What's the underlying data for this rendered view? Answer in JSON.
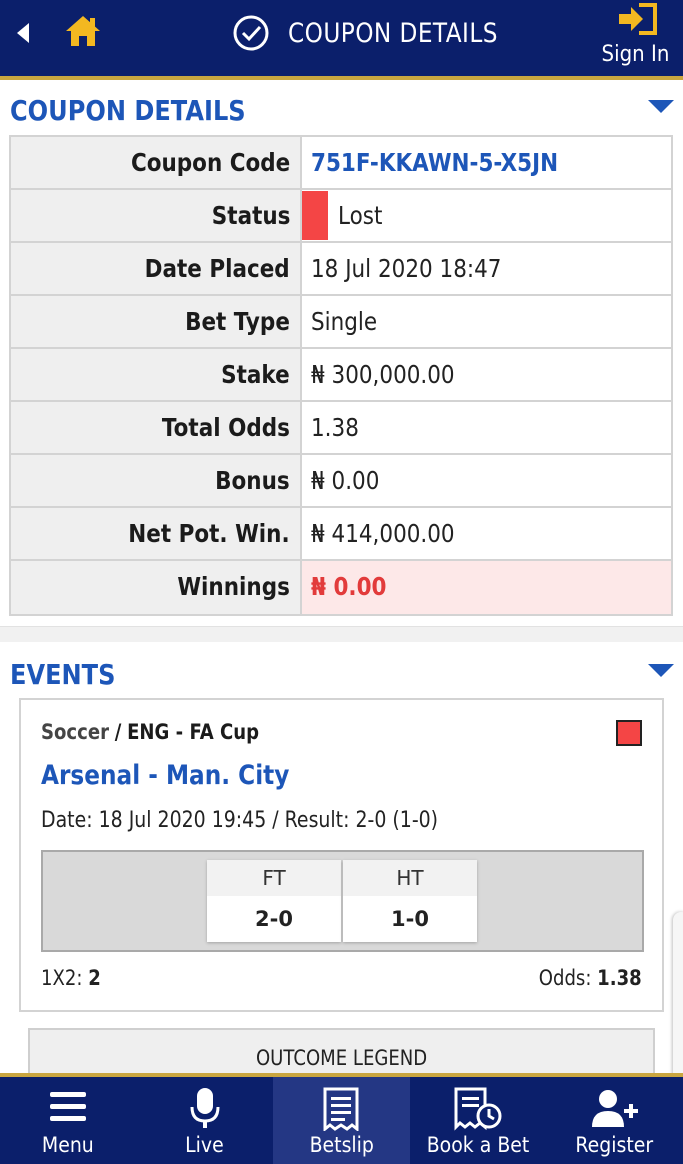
{
  "header": {
    "title": "COUPON DETAILS",
    "sign_in_label": "Sign In",
    "colors": {
      "bar": "#0b1f6b",
      "accent": "#c9a640",
      "home_icon": "#f3b821"
    }
  },
  "coupon_section": {
    "title": "COUPON DETAILS",
    "rows": [
      {
        "label": "Coupon Code",
        "value": "751F-KKAWN-5-X5JN"
      },
      {
        "label": "Status",
        "value": "Lost"
      },
      {
        "label": "Date Placed",
        "value": "18 Jul 2020 18:47"
      },
      {
        "label": "Bet Type",
        "value": "Single"
      },
      {
        "label": "Stake",
        "value": "₦ 300,000.00"
      },
      {
        "label": "Total Odds",
        "value": "1.38"
      },
      {
        "label": "Bonus",
        "value": "₦ 0.00"
      },
      {
        "label": "Net Pot. Win.",
        "value": "₦ 414,000.00"
      },
      {
        "label": "Winnings",
        "value": "₦ 0.00"
      }
    ],
    "status_color": "#f44545"
  },
  "events_section": {
    "title": "EVENTS",
    "event": {
      "sport": "Soccer",
      "separator": "/",
      "competition": "ENG - FA Cup",
      "match": "Arsenal - Man. City",
      "date_result": "Date: 18 Jul 2020 19:45 / Result: 2-0 (1-0)",
      "scores": [
        {
          "label": "FT",
          "value": "2-0"
        },
        {
          "label": "HT",
          "value": "1-0"
        }
      ],
      "market_label": "1X2:",
      "market_pick": "2",
      "odds_label": "Odds:",
      "odds_value": "1.38"
    },
    "legend_button": "OUTCOME LEGEND"
  },
  "bottom_nav": [
    {
      "label": "Menu",
      "icon": "menu-icon"
    },
    {
      "label": "Live",
      "icon": "microphone-icon"
    },
    {
      "label": "Betslip",
      "icon": "betslip-icon",
      "active": true
    },
    {
      "label": "Book a Bet",
      "icon": "book-bet-icon"
    },
    {
      "label": "Register",
      "icon": "add-user-icon"
    }
  ]
}
